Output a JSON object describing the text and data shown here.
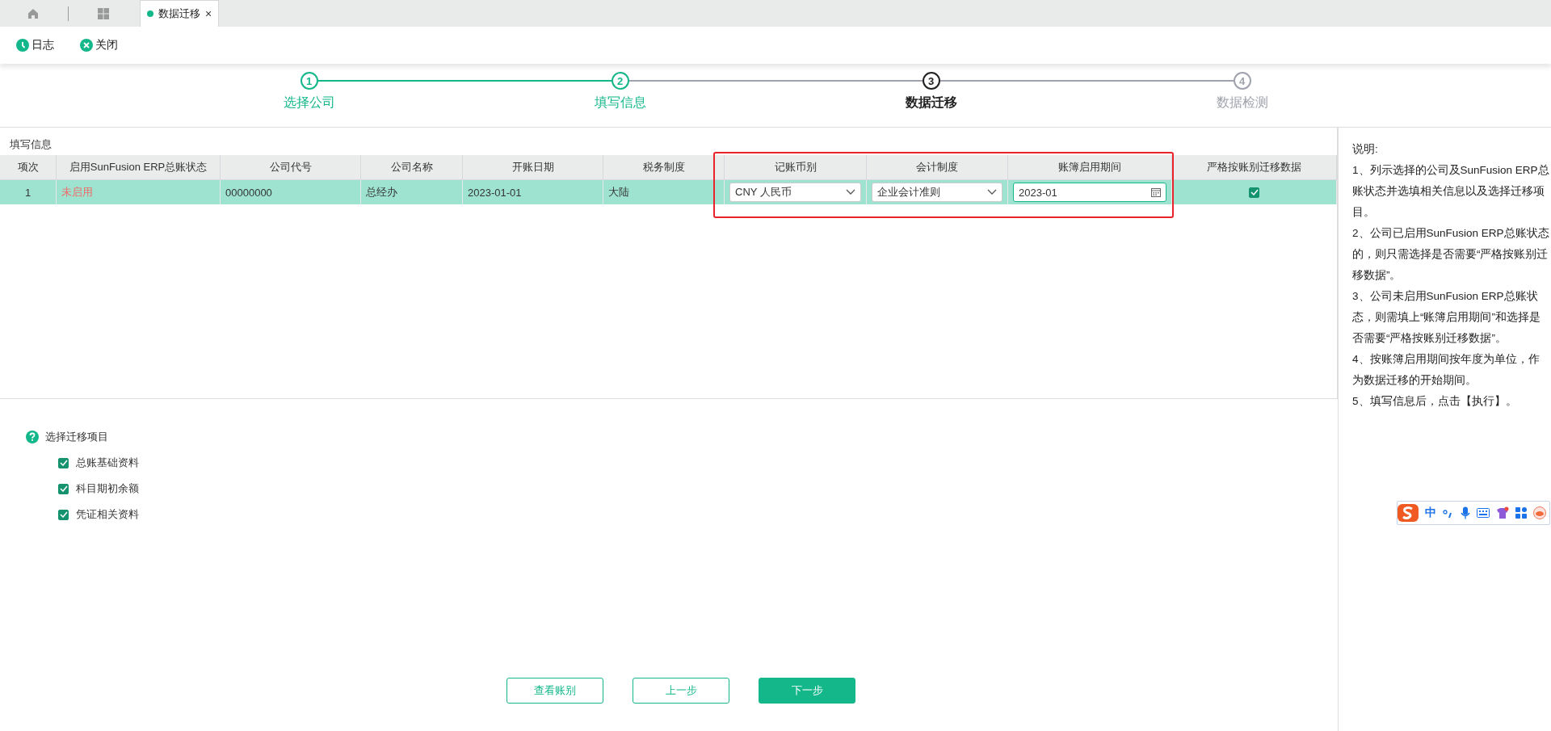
{
  "tabs": [
    {
      "kind": "home"
    },
    {
      "kind": "apps"
    },
    {
      "kind": "page",
      "label": "数据迁移",
      "selected": true,
      "close": "×"
    }
  ],
  "toolbar": [
    {
      "kind": "log",
      "label": "日志"
    },
    {
      "kind": "close",
      "label": "关闭"
    }
  ],
  "steps": [
    {
      "number": "1",
      "label": "选择公司",
      "completed": true,
      "selected": false
    },
    {
      "number": "2",
      "label": "填写信息",
      "completed": true,
      "selected": false
    },
    {
      "number": "3",
      "label": "数据迁移",
      "completed": false,
      "selected": true
    },
    {
      "number": "4",
      "label": "数据检测",
      "completed": false,
      "selected": false
    }
  ],
  "table": {
    "title": "填写信息",
    "columns": [
      "项次",
      "启用SunFusion ERP总账状态",
      "公司代号",
      "公司名称",
      "开账日期",
      "税务制度",
      "记账币别",
      "会计制度",
      "账簿启用期间",
      "严格按账别迁移数据"
    ],
    "rows": [
      {
        "selected": true,
        "index": "1",
        "status": "未启用",
        "status_enabled": false,
        "code": "00000000",
        "name": "总经办",
        "open_date": "2023-01-01",
        "tax": "大陆",
        "currency": "CNY 人民币",
        "accounting": "企业会计准则",
        "period": "2023-01",
        "strict": true
      }
    ]
  },
  "migration_items": {
    "title": "选择迁移项目",
    "items": [
      {
        "label": "总账基础资料",
        "checked": true
      },
      {
        "label": "科目期初余额",
        "checked": true
      },
      {
        "label": "凭证相关资料",
        "checked": true
      }
    ]
  },
  "buttons": [
    {
      "label": "查看账别",
      "kind": "outline"
    },
    {
      "label": "上一步",
      "kind": "outline"
    },
    {
      "label": "下一步",
      "kind": "primary"
    }
  ],
  "notes": {
    "title": "说明:",
    "lines": [
      "1、列示选择的公司及SunFusion ERP总账状态并选填相关信息以及选择迁移项目。",
      "2、公司已启用SunFusion ERP总账状态的，则只需选择是否需要“严格按账别迁移数据”。",
      "3、公司未启用SunFusion ERP总账状态，则需填上“账簿启用期间”和选择是否需要“严格按账别迁移数据”。",
      "4、按账簿启用期间按年度为单位，作为数据迁移的开始期间。",
      "5、填写信息后，点击【执行】。"
    ]
  },
  "ime_toolbar": {
    "mode": "中"
  }
}
